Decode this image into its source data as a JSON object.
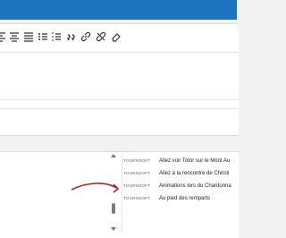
{
  "toolbar": {
    "icons": [
      "align-left-icon",
      "align-center-icon",
      "align-justify-icon",
      "bullet-list-icon",
      "numbered-list-icon",
      "blockquote-icon",
      "link-icon",
      "unlink-icon",
      "eraser-icon"
    ]
  },
  "list": {
    "items": [
      {
        "source": "TOURNSOFT",
        "title": "Allez voir Totor sur le Mont Au"
      },
      {
        "source": "TOURNSOFT",
        "title": "Allez à la rencontre de Christi"
      },
      {
        "source": "TOURNSOFT",
        "title": "Animations lors du Chardonna"
      },
      {
        "source": "TOURNSOFT",
        "title": "Au pied des remparts"
      }
    ]
  },
  "colors": {
    "accent": "#1e73be",
    "annotation": "#b22222"
  }
}
